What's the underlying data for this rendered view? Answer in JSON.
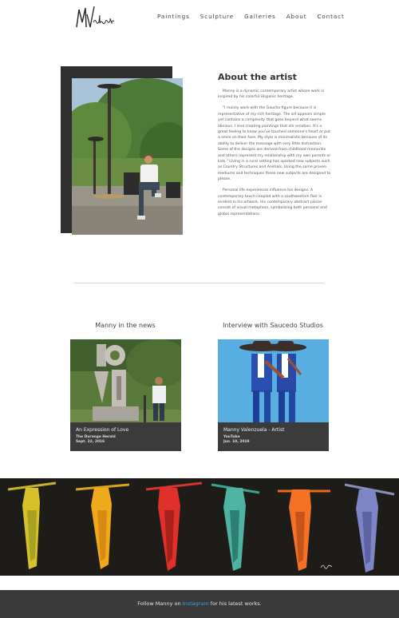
{
  "header": {
    "logo_text": "MValenzuela",
    "nav": [
      "Paintings",
      "Sculpture",
      "Galleries",
      "About",
      "Contact"
    ]
  },
  "about": {
    "title": "About the artist",
    "p1": "Manny is a dynamic contemporary artist whose work is inspired by his colorful Hispanic heritage.",
    "p2": "\"I mainly work with the Gaucho figure because it is representative of my rich heritage. The art appears simple yet contains a complexity that goes beyond what seems obvious. I love creating paintings that stir emotion. It's a great feeling to know you've touched someone's heart or put a smile on their face. My style is minimalistic because of its ability to deliver the message with very little distraction. Some of the designs are derived from childhood memories and others represent my relationship with my own parents or kids.\" Living in a rural setting has sparked new subjects such as Country Structures and Animals. Using the same proven mediums and techniques these new subjects are designed to please.",
    "p3": "Personal life experiences influence his designs. A contemporary touch coupled with a southwestern flair is evident in his artwork. His contemporary abstract pieces consist of visual metaphors, symbolizing both personal and global representations."
  },
  "news": {
    "left_heading": "Manny in the news",
    "right_heading": "Interview with Saucedo Studios",
    "cards": [
      {
        "title": "An Expression of Love",
        "source": "The Durango Herald",
        "date": "Sept. 22, 2016"
      },
      {
        "title": "Manny Valenzuela - Artist",
        "source": "YouTube",
        "date": "Jun. 10, 2019"
      }
    ]
  },
  "footer": {
    "before": "Follow Manny on ",
    "link": "Instagram",
    "after": " for his latest works."
  },
  "colors": {
    "dark": "#2f2f2f",
    "card_bg": "#3b3b3b",
    "footer_bg": "#3a3a3a",
    "link": "#3aa0e0"
  }
}
